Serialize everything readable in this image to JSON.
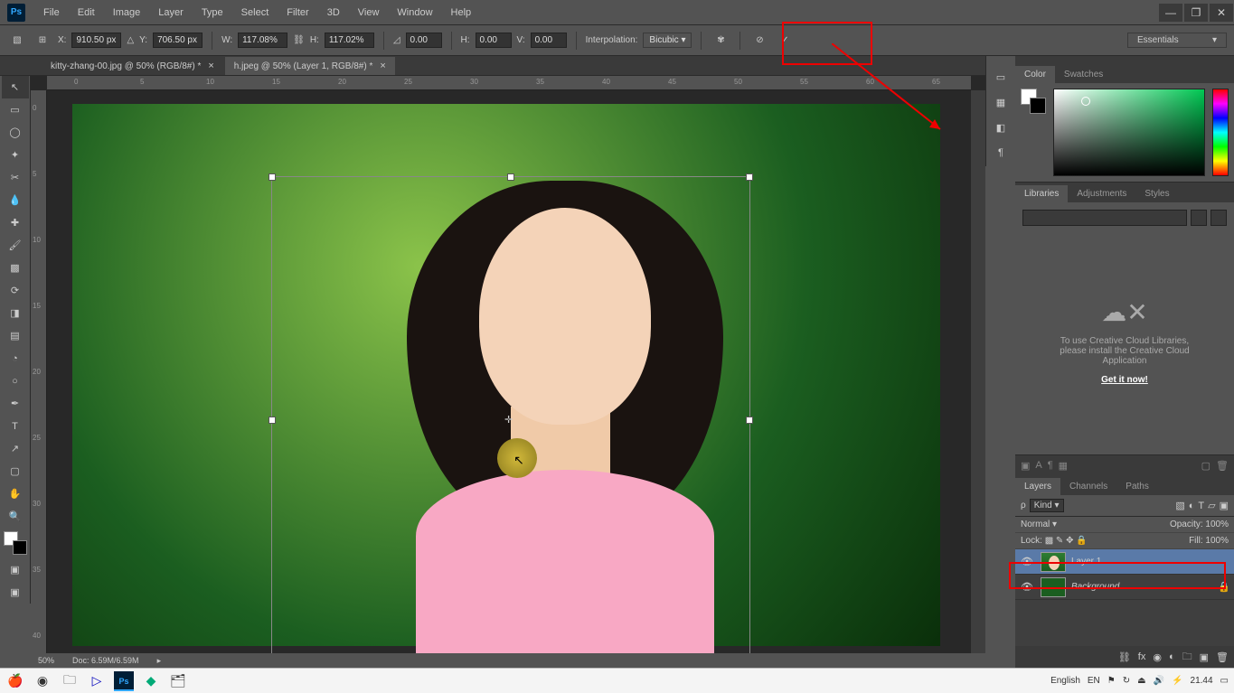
{
  "menu": {
    "items": [
      "File",
      "Edit",
      "Image",
      "Layer",
      "Type",
      "Select",
      "Filter",
      "3D",
      "View",
      "Window",
      "Help"
    ]
  },
  "window_controls": {
    "min": "—",
    "max": "❐",
    "close": "✕"
  },
  "options": {
    "x_label": "X:",
    "x": "910.50 px",
    "y_label": "Y:",
    "y": "706.50 px",
    "w_label": "W:",
    "w": "117.08%",
    "h_label": "H:",
    "h": "117.02%",
    "angle_label": "",
    "angle": "0.00",
    "skew_h_label": "H:",
    "skew_h": "0.00",
    "skew_v_label": "V:",
    "skew_v": "0.00",
    "interpolation_label": "Interpolation:",
    "interpolation": "Bicubic",
    "workspace": "Essentials"
  },
  "tabs": [
    {
      "title": "kitty-zhang-00.jpg @ 50% (RGB/8#) *",
      "active": false
    },
    {
      "title": "h.jpeg @ 50% (Layer 1, RGB/8#) *",
      "active": true
    }
  ],
  "ruler_h": [
    "0",
    "5",
    "10",
    "15",
    "20",
    "25",
    "30",
    "35",
    "40",
    "45",
    "50",
    "55",
    "60",
    "65"
  ],
  "ruler_v": [
    "0",
    "5",
    "10",
    "15",
    "20",
    "25",
    "30",
    "35",
    "40"
  ],
  "status": {
    "zoom": "50%",
    "doc": "Doc: 6.59M/6.59M"
  },
  "color_panel": {
    "tabs": [
      "Color",
      "Swatches"
    ]
  },
  "lib_panel": {
    "tabs": [
      "Libraries",
      "Adjustments",
      "Styles"
    ],
    "msg1": "To use Creative Cloud Libraries,",
    "msg2": "please install the Creative Cloud",
    "msg3": "Application",
    "cta": "Get it now!"
  },
  "layers_panel": {
    "tabs": [
      "Layers",
      "Channels",
      "Paths"
    ],
    "kind": "Kind",
    "blend": "Normal",
    "opacity_label": "Opacity:",
    "opacity": "100%",
    "lock_label": "Lock:",
    "fill_label": "Fill:",
    "fill": "100%",
    "layers": [
      {
        "name": "Layer 1",
        "selected": true,
        "locked": false
      },
      {
        "name": "Background",
        "selected": false,
        "locked": true
      }
    ]
  },
  "taskbar": {
    "lang_short": "EN",
    "lang_long": "English",
    "time": "21.44"
  }
}
